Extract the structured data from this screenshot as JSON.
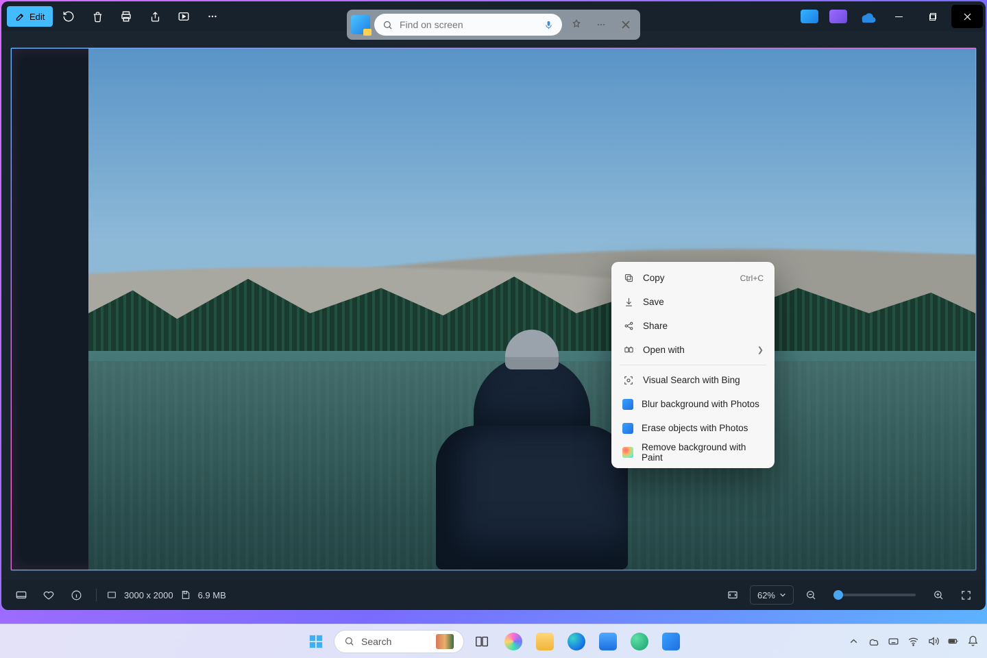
{
  "toolbar": {
    "edit_label": "Edit"
  },
  "search_overlay": {
    "placeholder": "Find on screen"
  },
  "context_menu": {
    "items": [
      {
        "label": "Copy",
        "shortcut": "Ctrl+C",
        "icon": "copy"
      },
      {
        "label": "Save",
        "icon": "save"
      },
      {
        "label": "Share",
        "icon": "share"
      },
      {
        "label": "Open with",
        "icon": "openwith",
        "submenu": true,
        "sep_after": true
      },
      {
        "label": "Visual Search with Bing",
        "icon": "visualsearch"
      },
      {
        "label": "Blur background with Photos",
        "icon": "photos"
      },
      {
        "label": "Erase objects with Photos",
        "icon": "photos"
      },
      {
        "label": "Remove background with Paint",
        "icon": "paint"
      }
    ]
  },
  "status": {
    "dimensions": "3000 x 2000",
    "filesize": "6.9 MB",
    "zoom_label": "62%"
  },
  "taskbar": {
    "search_placeholder": "Search"
  }
}
